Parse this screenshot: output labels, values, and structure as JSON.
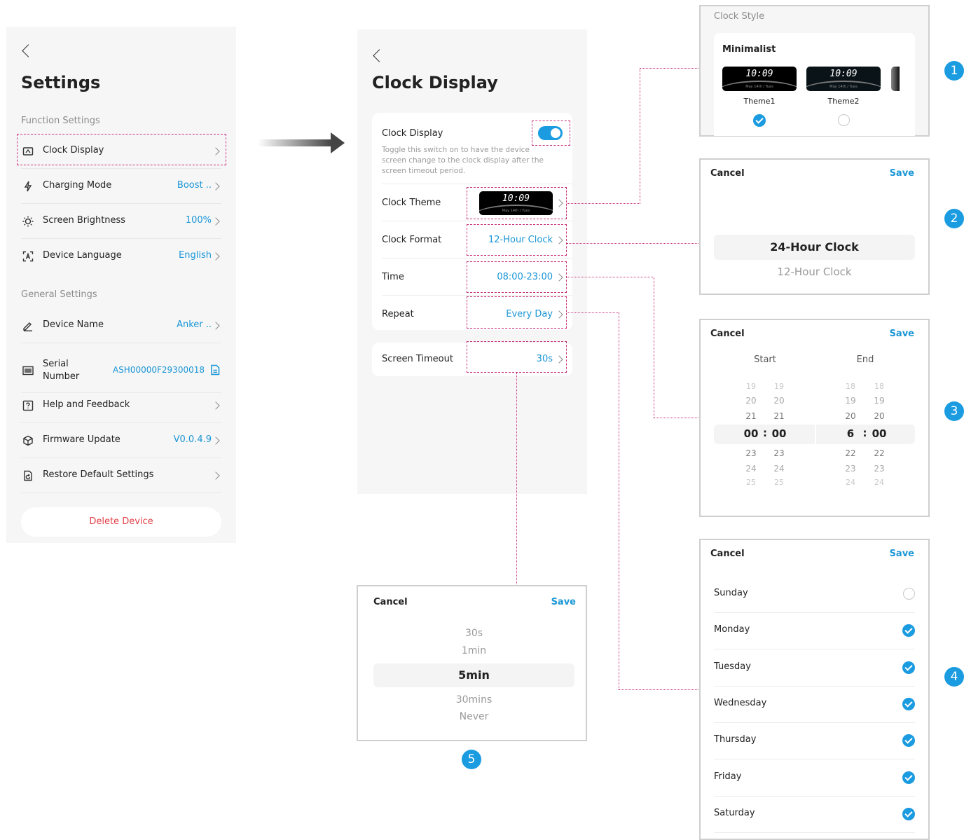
{
  "settings": {
    "title": "Settings",
    "function_section": "Function Settings",
    "general_section": "General Settings",
    "items": [
      {
        "label": "Clock Display",
        "value": "",
        "icon": "clock-display-icon"
      },
      {
        "label": "Charging Mode",
        "value": "Boost ..",
        "icon": "lightning-icon"
      },
      {
        "label": "Screen Brightness",
        "value": "100%",
        "icon": "sun-icon"
      },
      {
        "label": "Device Language",
        "value": "English",
        "icon": "language-icon"
      },
      {
        "label": "Device Name",
        "value": "Anker ..",
        "icon": "pencil-icon"
      },
      {
        "label": "Serial Number",
        "value": "ASH00000F29300018",
        "icon": "barcode-icon"
      },
      {
        "label": "Help and Feedback",
        "value": "",
        "icon": "help-icon"
      },
      {
        "label": "Firmware Update",
        "value": "V0.0.4.9",
        "icon": "cube-icon"
      },
      {
        "label": "Restore Default Settings",
        "value": "",
        "icon": "restore-icon"
      }
    ],
    "serial_label_line1": "Serial",
    "serial_label_line2": "Number",
    "delete_button": "Delete Device"
  },
  "clock_display": {
    "title": "Clock Display",
    "toggle_label": "Clock Display",
    "toggle_on": true,
    "toggle_desc_1": "Toggle this switch on to have the device",
    "toggle_desc_2": "screen change to the clock display after the",
    "toggle_desc_3": "screen timeout period.",
    "theme_label": "Clock Theme",
    "thumb_time": "10:09",
    "thumb_date": "May 14th / Tues",
    "format_label": "Clock Format",
    "format_value": "12-Hour Clock",
    "time_label": "Time",
    "time_value": "08:00-23:00",
    "repeat_label": "Repeat",
    "repeat_value": "Every Day",
    "timeout_label": "Screen Timeout",
    "timeout_value": "30s"
  },
  "clock_style": {
    "header": "Clock Style",
    "group": "Minimalist",
    "themes": [
      {
        "name": "Theme1",
        "time": "10:09",
        "date": "May 14th / Tues",
        "selected": true
      },
      {
        "name": "Theme2",
        "time": "10:09",
        "date": "May 14th / Tues",
        "selected": false
      }
    ]
  },
  "format_picker": {
    "cancel": "Cancel",
    "save": "Save",
    "selected": "24-Hour Clock",
    "other": "12-Hour Clock"
  },
  "time_picker": {
    "cancel": "Cancel",
    "save": "Save",
    "start_label": "Start",
    "end_label": "End",
    "start_above": [
      [
        "19",
        "19"
      ],
      [
        "20",
        "20"
      ],
      [
        "21",
        "21"
      ]
    ],
    "start_selected": [
      "00",
      "00"
    ],
    "start_below": [
      [
        "23",
        "23"
      ],
      [
        "24",
        "24"
      ],
      [
        "25",
        "25"
      ]
    ],
    "end_above": [
      [
        "18",
        "18"
      ],
      [
        "19",
        "19"
      ],
      [
        "20",
        "20"
      ]
    ],
    "end_selected": [
      "6",
      "00"
    ],
    "end_below": [
      [
        "22",
        "22"
      ],
      [
        "23",
        "23"
      ],
      [
        "24",
        "24"
      ]
    ],
    "colon": ":"
  },
  "repeat_picker": {
    "cancel": "Cancel",
    "save": "Save",
    "days": [
      {
        "name": "Sunday",
        "checked": false
      },
      {
        "name": "Monday",
        "checked": true
      },
      {
        "name": "Tuesday",
        "checked": true
      },
      {
        "name": "Wednesday",
        "checked": true
      },
      {
        "name": "Thursday",
        "checked": true
      },
      {
        "name": "Friday",
        "checked": true
      },
      {
        "name": "Saturday",
        "checked": true
      }
    ]
  },
  "timeout_picker": {
    "cancel": "Cancel",
    "save": "Save",
    "options_above": [
      "30s",
      "1min"
    ],
    "selected": "5min",
    "options_below": [
      "30mins",
      "Never"
    ]
  },
  "badges": [
    "1",
    "2",
    "3",
    "4",
    "5"
  ],
  "colors": {
    "accent": "#1a96d6",
    "delete": "#e0424a",
    "annotation": "#c8327a"
  }
}
